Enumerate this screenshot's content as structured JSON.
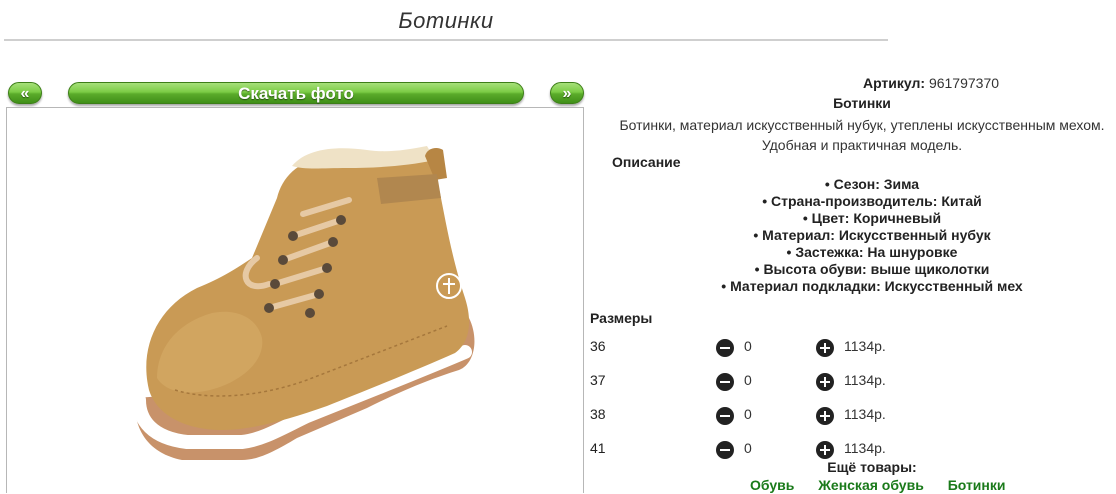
{
  "page": {
    "title": "Ботинки"
  },
  "gallery": {
    "prev_label": "«",
    "download_label": "Скачать фото",
    "next_label": "»"
  },
  "product": {
    "article_label": "Артикул:",
    "article_value": "961797370",
    "name": "Ботинки",
    "description_line1": "Ботинки, материал искусственный нубук, утеплены искусственным мехом.",
    "description_line2": "Удобная и практичная модель.",
    "description_heading": "Описание",
    "properties": [
      "• Сезон: Зима",
      "• Страна-производитель: Китай",
      "• Цвет: Коричневый",
      "• Материал: Искусственный нубук",
      "• Застежка: На шнуровке",
      "• Высота обуви: выше щиколотки",
      "• Материал подкладки: Искусственный мех"
    ]
  },
  "sizes": {
    "heading": "Размеры",
    "rows": [
      {
        "size": "36",
        "qty": "0",
        "price": "1134р."
      },
      {
        "size": "37",
        "qty": "0",
        "price": "1134р."
      },
      {
        "size": "38",
        "qty": "0",
        "price": "1134р."
      },
      {
        "size": "41",
        "qty": "0",
        "price": "1134р."
      }
    ]
  },
  "more": {
    "heading": "Ещё товары:",
    "links": [
      "Обувь",
      "Женская обувь",
      "Ботинки"
    ]
  },
  "colors": {
    "button_green": "#6cbf38",
    "link_green": "#1a7a1a",
    "boot_tan": "#c99a55",
    "sole_brown": "#c8926a"
  }
}
